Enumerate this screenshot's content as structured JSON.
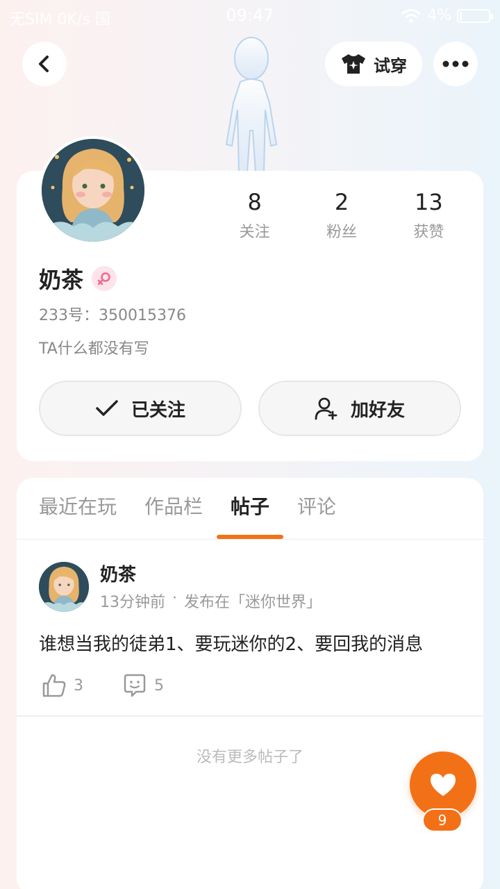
{
  "status_bar": {
    "carrier": "无SIM 0K/s 国",
    "time": "09:47",
    "battery": "4%"
  },
  "header": {
    "back_icon": "chevron-left-icon",
    "tryon_label": "试穿",
    "more_icon": "ellipsis-icon"
  },
  "profile": {
    "stats": [
      {
        "value": "8",
        "label": "关注"
      },
      {
        "value": "2",
        "label": "粉丝"
      },
      {
        "value": "13",
        "label": "获赞"
      }
    ],
    "name": "奶茶",
    "gender_icon": "female-icon",
    "uid": "233号：350015376",
    "bio": "TA什么都没有写",
    "follow_label": "已关注",
    "add_friend_label": "加好友"
  },
  "tabs": [
    {
      "label": "最近在玩"
    },
    {
      "label": "作品栏"
    },
    {
      "label": "帖子"
    },
    {
      "label": "评论"
    }
  ],
  "post": {
    "author": "奶茶",
    "time": "13分钟前",
    "dot": "·",
    "source": "发布在「迷你世界」",
    "text": "谁想当我的徒弟1、要玩迷你的2、要回我的消息",
    "likes": "3",
    "comments": "5"
  },
  "footer": {
    "no_more": "没有更多帖子了",
    "like_count": "9"
  },
  "colors": {
    "accent": "#f37116"
  }
}
